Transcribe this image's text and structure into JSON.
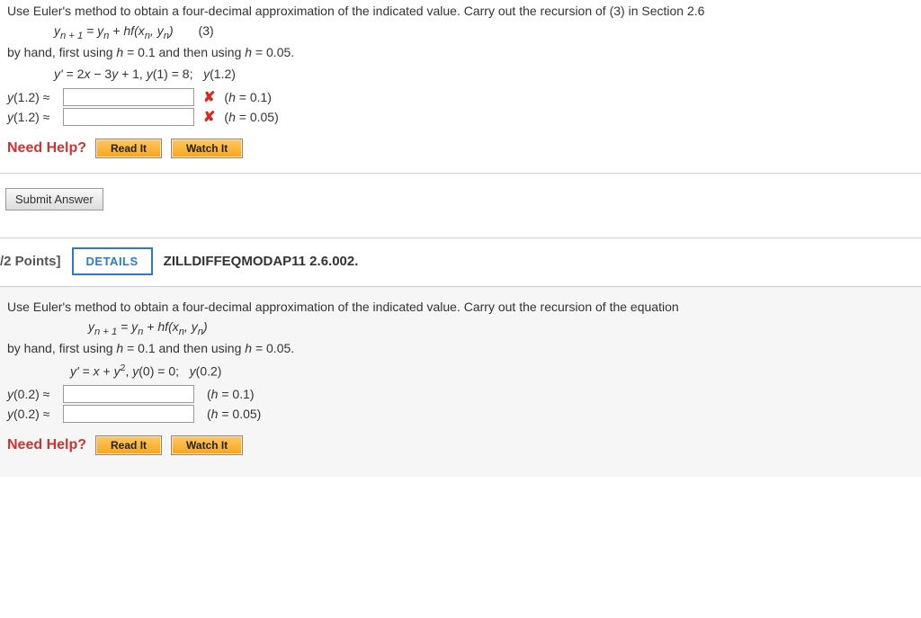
{
  "q1": {
    "prompt": "Use Euler's method to obtain a four-decimal approximation of the indicated value. Carry out the recursion of (3) in Section 2.6",
    "formula_html": "y<sub>n + 1</sub> = y<sub>n</sub> + hf(x<sub>n</sub>, y<sub>n</sub>)",
    "eq_label": "(3)",
    "by_hand": "by hand, first using h = 0.1 and then using h = 0.05.",
    "equation": "y' = 2x − 3y + 1, y(1) = 8;   y(1.2)",
    "answers": [
      {
        "label": "y(1.2) ≈",
        "value": "",
        "marked_wrong": true,
        "h_note": "(h = 0.1)"
      },
      {
        "label": "y(1.2) ≈",
        "value": "",
        "marked_wrong": true,
        "h_note": "(h = 0.05)"
      }
    ]
  },
  "help": {
    "label": "Need Help?",
    "read": "Read It",
    "watch": "Watch It"
  },
  "submit": "Submit Answer",
  "section": {
    "points": "/2 Points]",
    "details": "DETAILS",
    "reference": "ZILLDIFFEQMODAP11 2.6.002."
  },
  "q2": {
    "prompt": "Use Euler's method to obtain a four-decimal approximation of the indicated value. Carry out the recursion of the equation",
    "formula_html": "y<sub>n + 1</sub> = y<sub>n</sub> + hf(x<sub>n</sub>, y<sub>n</sub>)",
    "by_hand": "by hand, first using h = 0.1 and then using h = 0.05.",
    "equation_html": "y' = x + y<sup>2</sup>, y(0) = 0;   y(0.2)",
    "answers": [
      {
        "label": "y(0.2) ≈",
        "value": "",
        "h_note": "(h = 0.1)"
      },
      {
        "label": "y(0.2) ≈",
        "value": "",
        "h_note": "(h = 0.05)"
      }
    ]
  }
}
